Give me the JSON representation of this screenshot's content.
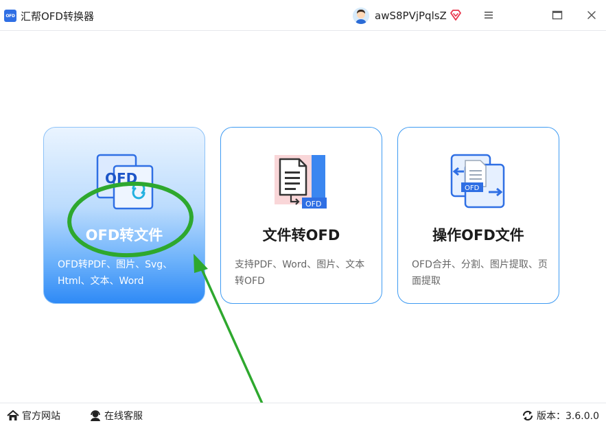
{
  "app": {
    "logo_text": "OFD",
    "title": "汇帮OFD转换器"
  },
  "user": {
    "name": "awS8PVjPqlsZ"
  },
  "window_controls": [
    "menu-icon",
    "maximize-icon",
    "close-icon"
  ],
  "cards": [
    {
      "title": "OFD转文件",
      "description": "OFD转PDF、图片、Svg、Html、文本、Word",
      "icon": "ofd-to-file-icon",
      "icon_text": "OFD",
      "selected": true
    },
    {
      "title": "文件转OFD",
      "description": "支持PDF、Word、图片、文本转OFD",
      "icon": "file-to-ofd-icon",
      "icon_text": "OFD"
    },
    {
      "title": "操作OFD文件",
      "description": "OFD合并、分割、图片提取、页面提取",
      "icon": "ofd-operate-icon",
      "icon_text": "OFD"
    }
  ],
  "footer": {
    "website": "官方网站",
    "support": "在线客服",
    "version": "版本：3.6.0.0"
  },
  "colors": {
    "accent": "#2f8af6",
    "card_border": "#3d9af2",
    "annotation": "#2ea82e"
  }
}
